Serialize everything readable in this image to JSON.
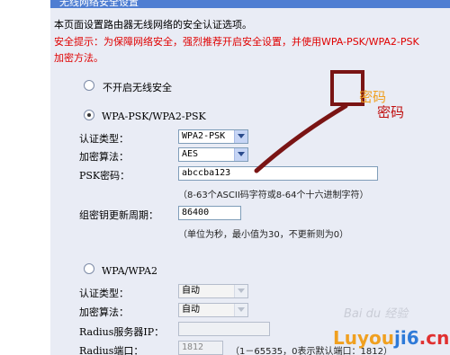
{
  "title": "无线网络安全设置",
  "intro": "本页面设置路由器无线网络的安全认证选项。",
  "warning_line1": "安全提示：为保障网络安全，强烈推荐开启安全设置，并使用WPA-PSK/WPA2-PSK",
  "warning_line2": "加密方法。",
  "option_none": "不开启无线安全",
  "option_psk": "WPA-PSK/WPA2-PSK",
  "psk": {
    "auth_label": "认证类型：",
    "auth_value": "WPA2-PSK",
    "enc_label": "加密算法：",
    "enc_value": "AES",
    "key_label": "PSK密码：",
    "key_value": "abccba123",
    "key_hint": "（8-63个ASCII码字符或8-64个十六进制字符）",
    "renew_label": "组密钥更新周期：",
    "renew_value": "86400",
    "renew_hint": "（单位为秒，最小值为30，不更新则为0）"
  },
  "option_wpa": "WPA/WPA2",
  "wpa": {
    "auth_label": "认证类型：",
    "auth_value": "自动",
    "enc_label": "加密算法：",
    "enc_value": "自动",
    "radius_ip_label": "Radius服务器IP：",
    "radius_port_label": "Radius端口：",
    "radius_port_value": "1812",
    "radius_port_hint": "（1－65535，0表示默认端口：1812）"
  },
  "annotation": {
    "label_a": "密码",
    "label_b": "密码",
    "color": "#7a1414"
  },
  "watermark": {
    "part1": "Luyou",
    "part2": "ji6",
    "part3": ".cn",
    "baidu": "Bai du 经验"
  },
  "colors": {
    "panel": "#e9ecf5",
    "titlebar": "#4f7ed2",
    "warning": "#e00000"
  }
}
